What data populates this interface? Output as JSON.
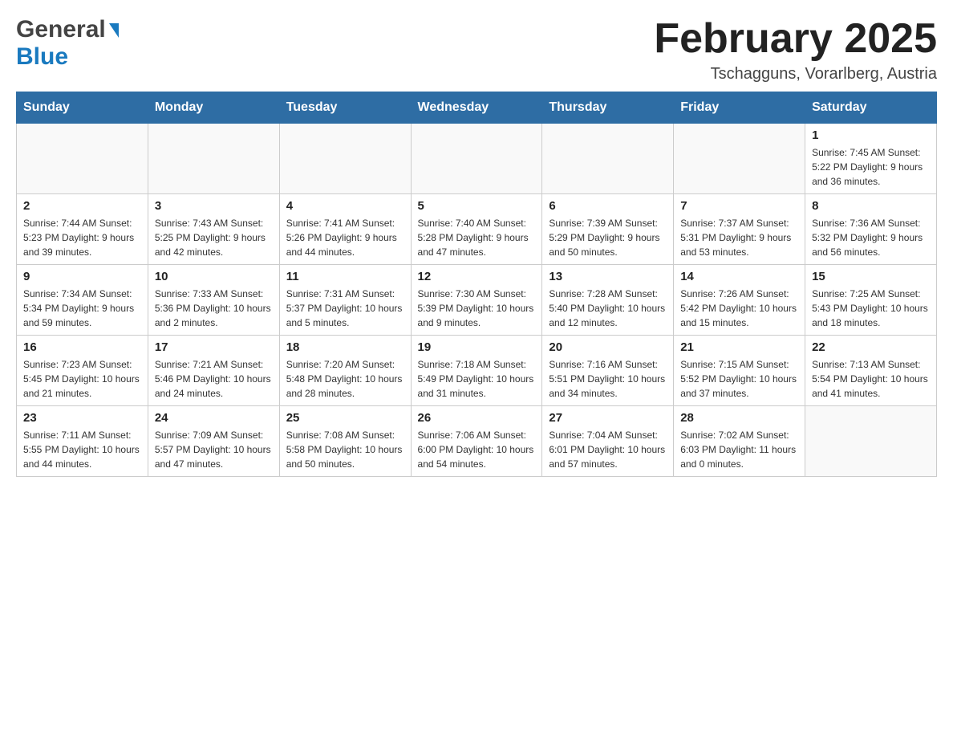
{
  "header": {
    "logo_general": "General",
    "logo_blue": "Blue",
    "title": "February 2025",
    "location": "Tschagguns, Vorarlberg, Austria"
  },
  "days_of_week": [
    "Sunday",
    "Monday",
    "Tuesday",
    "Wednesday",
    "Thursday",
    "Friday",
    "Saturday"
  ],
  "weeks": [
    [
      {
        "day": "",
        "info": ""
      },
      {
        "day": "",
        "info": ""
      },
      {
        "day": "",
        "info": ""
      },
      {
        "day": "",
        "info": ""
      },
      {
        "day": "",
        "info": ""
      },
      {
        "day": "",
        "info": ""
      },
      {
        "day": "1",
        "info": "Sunrise: 7:45 AM\nSunset: 5:22 PM\nDaylight: 9 hours and 36 minutes."
      }
    ],
    [
      {
        "day": "2",
        "info": "Sunrise: 7:44 AM\nSunset: 5:23 PM\nDaylight: 9 hours and 39 minutes."
      },
      {
        "day": "3",
        "info": "Sunrise: 7:43 AM\nSunset: 5:25 PM\nDaylight: 9 hours and 42 minutes."
      },
      {
        "day": "4",
        "info": "Sunrise: 7:41 AM\nSunset: 5:26 PM\nDaylight: 9 hours and 44 minutes."
      },
      {
        "day": "5",
        "info": "Sunrise: 7:40 AM\nSunset: 5:28 PM\nDaylight: 9 hours and 47 minutes."
      },
      {
        "day": "6",
        "info": "Sunrise: 7:39 AM\nSunset: 5:29 PM\nDaylight: 9 hours and 50 minutes."
      },
      {
        "day": "7",
        "info": "Sunrise: 7:37 AM\nSunset: 5:31 PM\nDaylight: 9 hours and 53 minutes."
      },
      {
        "day": "8",
        "info": "Sunrise: 7:36 AM\nSunset: 5:32 PM\nDaylight: 9 hours and 56 minutes."
      }
    ],
    [
      {
        "day": "9",
        "info": "Sunrise: 7:34 AM\nSunset: 5:34 PM\nDaylight: 9 hours and 59 minutes."
      },
      {
        "day": "10",
        "info": "Sunrise: 7:33 AM\nSunset: 5:36 PM\nDaylight: 10 hours and 2 minutes."
      },
      {
        "day": "11",
        "info": "Sunrise: 7:31 AM\nSunset: 5:37 PM\nDaylight: 10 hours and 5 minutes."
      },
      {
        "day": "12",
        "info": "Sunrise: 7:30 AM\nSunset: 5:39 PM\nDaylight: 10 hours and 9 minutes."
      },
      {
        "day": "13",
        "info": "Sunrise: 7:28 AM\nSunset: 5:40 PM\nDaylight: 10 hours and 12 minutes."
      },
      {
        "day": "14",
        "info": "Sunrise: 7:26 AM\nSunset: 5:42 PM\nDaylight: 10 hours and 15 minutes."
      },
      {
        "day": "15",
        "info": "Sunrise: 7:25 AM\nSunset: 5:43 PM\nDaylight: 10 hours and 18 minutes."
      }
    ],
    [
      {
        "day": "16",
        "info": "Sunrise: 7:23 AM\nSunset: 5:45 PM\nDaylight: 10 hours and 21 minutes."
      },
      {
        "day": "17",
        "info": "Sunrise: 7:21 AM\nSunset: 5:46 PM\nDaylight: 10 hours and 24 minutes."
      },
      {
        "day": "18",
        "info": "Sunrise: 7:20 AM\nSunset: 5:48 PM\nDaylight: 10 hours and 28 minutes."
      },
      {
        "day": "19",
        "info": "Sunrise: 7:18 AM\nSunset: 5:49 PM\nDaylight: 10 hours and 31 minutes."
      },
      {
        "day": "20",
        "info": "Sunrise: 7:16 AM\nSunset: 5:51 PM\nDaylight: 10 hours and 34 minutes."
      },
      {
        "day": "21",
        "info": "Sunrise: 7:15 AM\nSunset: 5:52 PM\nDaylight: 10 hours and 37 minutes."
      },
      {
        "day": "22",
        "info": "Sunrise: 7:13 AM\nSunset: 5:54 PM\nDaylight: 10 hours and 41 minutes."
      }
    ],
    [
      {
        "day": "23",
        "info": "Sunrise: 7:11 AM\nSunset: 5:55 PM\nDaylight: 10 hours and 44 minutes."
      },
      {
        "day": "24",
        "info": "Sunrise: 7:09 AM\nSunset: 5:57 PM\nDaylight: 10 hours and 47 minutes."
      },
      {
        "day": "25",
        "info": "Sunrise: 7:08 AM\nSunset: 5:58 PM\nDaylight: 10 hours and 50 minutes."
      },
      {
        "day": "26",
        "info": "Sunrise: 7:06 AM\nSunset: 6:00 PM\nDaylight: 10 hours and 54 minutes."
      },
      {
        "day": "27",
        "info": "Sunrise: 7:04 AM\nSunset: 6:01 PM\nDaylight: 10 hours and 57 minutes."
      },
      {
        "day": "28",
        "info": "Sunrise: 7:02 AM\nSunset: 6:03 PM\nDaylight: 11 hours and 0 minutes."
      },
      {
        "day": "",
        "info": ""
      }
    ]
  ]
}
